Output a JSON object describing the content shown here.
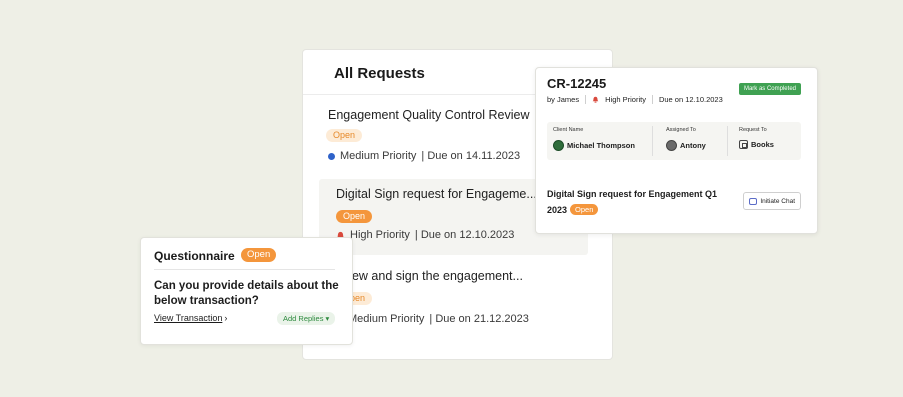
{
  "requests_panel": {
    "title": "All Requests",
    "items": [
      {
        "title": "Engagement Quality Control Review",
        "status": "Open",
        "priority": "Medium Priority",
        "due": "| Due on 14.11.2023"
      },
      {
        "title": "Digital Sign request for Engageme...",
        "status": "Open",
        "priority": "High Priority",
        "due": "| Due on 12.10.2023"
      },
      {
        "title": "eview and sign the engagement...",
        "status": "Open",
        "priority": "Medium Priority",
        "due": "| Due on 21.12.2023"
      }
    ]
  },
  "questionnaire": {
    "title": "Questionnaire",
    "status": "Open",
    "question": "Can you provide details about the below transaction?",
    "link": "View Transaction",
    "add_replies": "Add Replies"
  },
  "cr_card": {
    "id": "CR-12245",
    "by": "by James",
    "priority": "High Priority",
    "due": "Due on 12.10.2023",
    "status_button": "Mark as Completed",
    "client_label": "Client Name",
    "client_value": "Michael Thompson",
    "assigned_label": "Assigned To",
    "assigned_value": "Antony",
    "request_label": "Request To",
    "request_value": "Books",
    "description": "Digital Sign request for Engagement Q1 2023",
    "badge": "Open",
    "chat_button": "Initiate Chat"
  },
  "colors": {
    "background": "#eeefe6",
    "open_orange": "#f4963c",
    "priority_medium": "#2e62c9",
    "priority_high": "#d94a3d",
    "complete_green": "#3fa152"
  }
}
